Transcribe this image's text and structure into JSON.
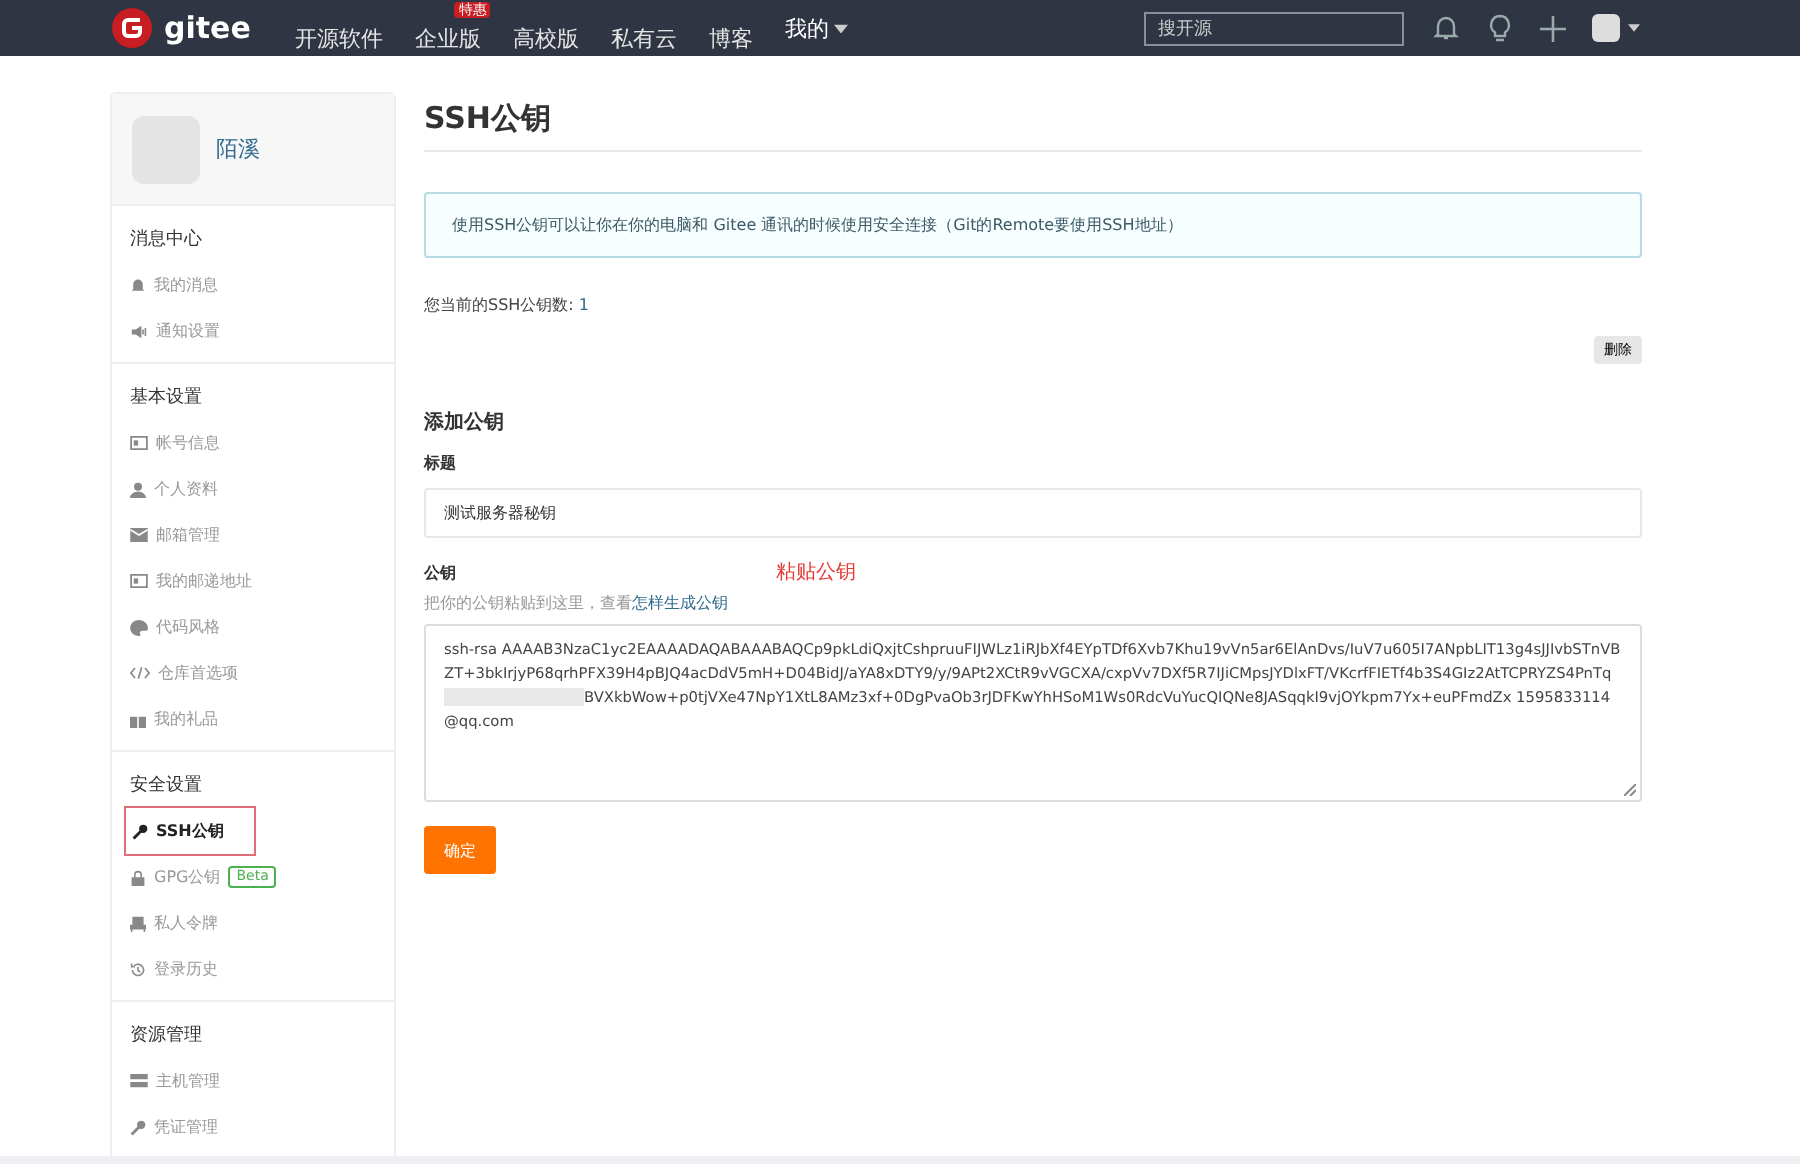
{
  "header": {
    "logo": "gitee",
    "nav": [
      {
        "label": "开源软件"
      },
      {
        "label": "企业版",
        "badge": "特惠"
      },
      {
        "label": "高校版"
      },
      {
        "label": "私有云"
      },
      {
        "label": "博客"
      }
    ],
    "my_menu": "我的",
    "search": {
      "placeholder": "搜开源"
    }
  },
  "sidebar": {
    "username": "陌溪",
    "groups": [
      {
        "title": "消息中心",
        "items": [
          {
            "label": "我的消息",
            "selected": false
          },
          {
            "label": "通知设置",
            "selected": false
          }
        ]
      },
      {
        "title": "基本设置",
        "items": [
          {
            "label": "帐号信息",
            "selected": false
          },
          {
            "label": "个人资料",
            "selected": false
          },
          {
            "label": "邮箱管理",
            "selected": false
          },
          {
            "label": "我的邮递地址",
            "selected": false
          },
          {
            "label": "代码风格",
            "selected": false
          },
          {
            "label": "仓库首选项",
            "selected": false
          },
          {
            "label": "我的礼品",
            "selected": false
          }
        ]
      },
      {
        "title": "安全设置",
        "items": [
          {
            "label": "SSH公钥",
            "selected": true
          },
          {
            "label": "GPG公钥",
            "selected": false,
            "badge": "Beta"
          },
          {
            "label": "私人令牌",
            "selected": false
          },
          {
            "label": "登录历史",
            "selected": false
          }
        ]
      },
      {
        "title": "资源管理",
        "items": [
          {
            "label": "主机管理",
            "selected": false
          },
          {
            "label": "凭证管理",
            "selected": false
          }
        ]
      }
    ]
  },
  "main": {
    "title": "SSH公钥",
    "notice": "使用SSH公钥可以让你在你的电脑和 Gitee 通讯的时候使用安全连接（Git的Remote要使用SSH地址）",
    "count_label": "您当前的SSH公钥数: ",
    "count": "1",
    "delete_button": "删除",
    "add_title": "添加公钥",
    "title_label": "标题",
    "title_value": "测试服务器秘钥",
    "key_label": "公钥",
    "key_hint": "把你的公钥粘贴到这里，查看 ",
    "key_link": "怎样生成公钥",
    "annotation": "粘贴公钥",
    "key_before": "ssh-rsa AAAAB3NzaC1yc2EAAAADAQABAAABAQCp9pkLdiQxjtCshpruuFIJWLz1iRJbXf4EYpTDf6Xvb7Khu19vVn5ar6ElAnDvs/IuV7u605I7ANpbLIT13g4sJJIvbSTnVBZT+3bkIrjyP68qrhPFX39H4pBJQ4acDdV5mH+D04BidJ/aYA8xDTY9/y/9APt2XCtR9vVGCXA/cxpVv7DXf5R7IJiCMpsJYDlxFT/VKcrfFIETf4b3S4GIz2AtTCPRYZS4PnTq",
    "key_after": "BVXkbWow+p0tjVXe47NpY1XtL8AMz3xf+0DgPvaOb3rJDFKwYhHSoM1Ws0RdcVuYucQIQNe8JASqqkI9vjOYkpm7Yx+euPFmdZx 1595833114@qq.com",
    "confirm_button": "确定"
  }
}
